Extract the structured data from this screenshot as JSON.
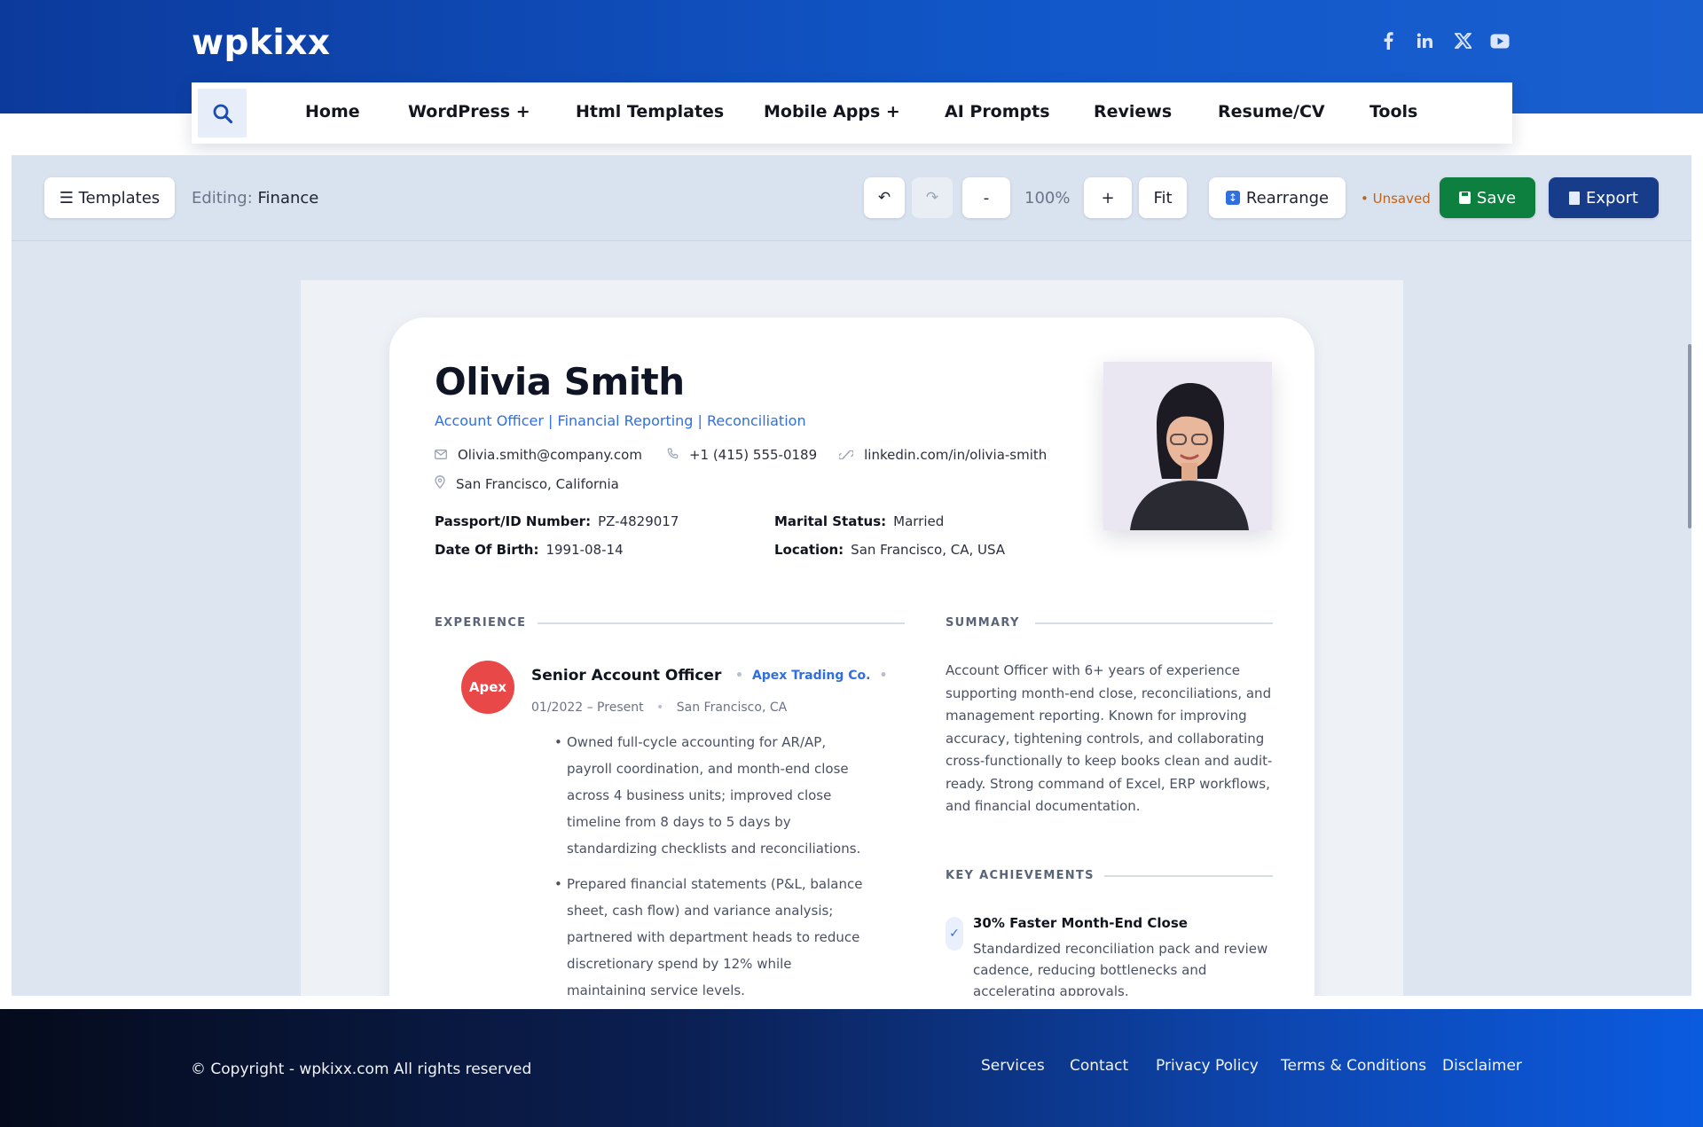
{
  "site": {
    "logo": "wpkixx",
    "social": [
      "facebook-icon",
      "linkedin-icon",
      "x-icon",
      "youtube-icon"
    ]
  },
  "nav": {
    "items": [
      "Home",
      "WordPress +",
      "Html Templates",
      "Mobile Apps +",
      "AI Prompts",
      "Reviews",
      "Resume/CV",
      "Tools"
    ]
  },
  "toolbar": {
    "templates": "☰ Templates",
    "editing_label": "Editing:",
    "editing_value": "Finance",
    "undo": "↶",
    "redo": "↷",
    "zoom_out": "-",
    "zoom": "100%",
    "zoom_in": "+",
    "fit": "Fit",
    "rearrange": "Rearrange",
    "unsaved": "• Unsaved",
    "save": "Save",
    "export": "Export"
  },
  "resume": {
    "name": "Olivia Smith",
    "headline": "Account Officer | Financial Reporting | Reconciliation",
    "email": "Olivia.smith@company.com",
    "phone": "+1 (415) 555-0189",
    "linkedin": "linkedin.com/in/olivia-smith",
    "location": "San Francisco, California",
    "facts": {
      "passport_label": "Passport/ID Number:",
      "passport": "PZ-4829017",
      "dob_label": "Date Of Birth:",
      "dob": "1991-08-14",
      "marital_label": "Marital Status:",
      "marital": "Married",
      "location_label": "Location:",
      "location": "San Francisco, CA, USA"
    },
    "experience_title": "EXPERIENCE",
    "job": {
      "logo": "Apex",
      "title": "Senior Account Officer",
      "company": "Apex Trading Co.",
      "dates": "01/2022 – Present",
      "place": "San Francisco, CA",
      "bullets": [
        "Owned full-cycle accounting for AR/AP, payroll coordination, and month-end close across 4 business units; improved close timeline from 8 days to 5 days by standardizing checklists and reconciliations.",
        "Prepared financial statements (P&L, balance sheet, cash flow) and variance analysis; partnered with department heads to reduce discretionary spend by 12% while maintaining service levels."
      ]
    },
    "summary_title": "SUMMARY",
    "summary": "Account Officer with 6+ years of experience supporting month-end close, reconciliations, and management reporting. Known for improving accuracy, tightening controls, and collaborating cross-functionally to keep books clean and audit-ready. Strong command of Excel, ERP workflows, and financial documentation.",
    "achievements_title": "KEY ACHIEVEMENTS",
    "achievement": {
      "title": "30% Faster Month-End Close",
      "desc": "Standardized reconciliation pack and review cadence, reducing bottlenecks and accelerating approvals."
    }
  },
  "footer": {
    "copyright": "© Copyright - wpkixx.com All rights reserved",
    "links": [
      "Services",
      "Contact",
      "Privacy Policy",
      "Terms & Conditions",
      "Disclaimer"
    ]
  },
  "colors": {
    "brand": "#1157c9",
    "accent": "#2f6fe0",
    "save": "#0d8040",
    "export": "#163c8a",
    "unsaved": "#c0631a",
    "apex": "#e84848"
  }
}
